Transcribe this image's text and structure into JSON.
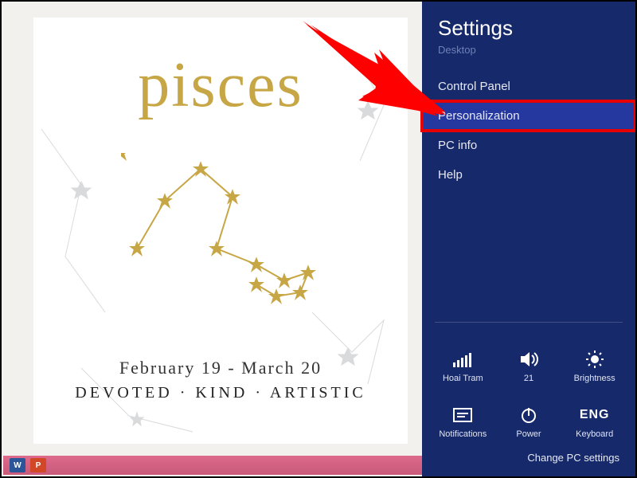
{
  "wallpaper": {
    "script_title": "pisces",
    "date_range": "February 19 - March 20",
    "traits": "DEVOTED · KIND · ARTISTIC"
  },
  "taskbar": {
    "word_icon": "W",
    "ppt_icon": "P"
  },
  "settings": {
    "title": "Settings",
    "subtitle": "Desktop",
    "items": [
      {
        "label": "Control Panel",
        "highlight": false
      },
      {
        "label": "Personalization",
        "highlight": true
      },
      {
        "label": "PC info",
        "highlight": false
      },
      {
        "label": "Help",
        "highlight": false
      }
    ],
    "tiles": {
      "network": {
        "label": "Hoai Tram"
      },
      "volume": {
        "label": "21"
      },
      "brightness": {
        "label": "Brightness"
      },
      "notifications": {
        "label": "Notifications"
      },
      "power": {
        "label": "Power"
      },
      "keyboard": {
        "label": "Keyboard",
        "lang": "ENG"
      }
    },
    "change_link": "Change PC settings"
  }
}
